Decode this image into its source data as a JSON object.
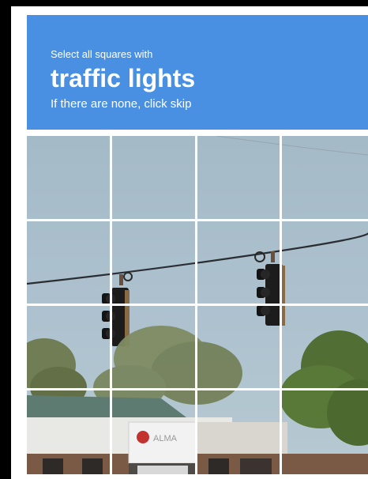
{
  "challenge": {
    "instruction": "Select all squares with",
    "target": "traffic lights",
    "subtext": "If there are none, click skip"
  },
  "grid": {
    "rows": 4,
    "cols": 4,
    "tiles": [
      {
        "row": 1,
        "col": 1
      },
      {
        "row": 1,
        "col": 2
      },
      {
        "row": 1,
        "col": 3
      },
      {
        "row": 1,
        "col": 4
      },
      {
        "row": 2,
        "col": 1
      },
      {
        "row": 2,
        "col": 2
      },
      {
        "row": 2,
        "col": 3
      },
      {
        "row": 2,
        "col": 4
      },
      {
        "row": 3,
        "col": 1
      },
      {
        "row": 3,
        "col": 2
      },
      {
        "row": 3,
        "col": 3
      },
      {
        "row": 3,
        "col": 4
      },
      {
        "row": 4,
        "col": 1
      },
      {
        "row": 4,
        "col": 2
      },
      {
        "row": 4,
        "col": 3
      },
      {
        "row": 4,
        "col": 4
      }
    ]
  },
  "colors": {
    "header_bg": "#4a90e2",
    "sky": "#a9bfcc",
    "grid_line": "#ffffff"
  },
  "image": {
    "sign_text": "ALMA"
  }
}
